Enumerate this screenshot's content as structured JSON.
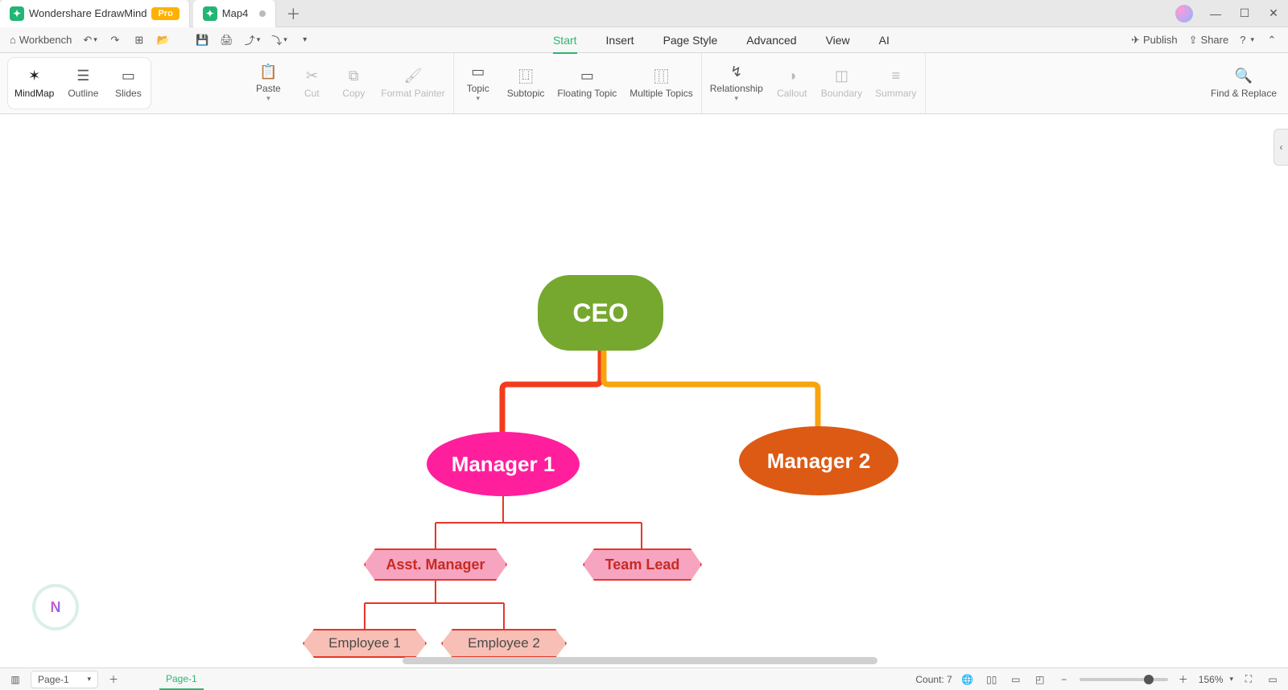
{
  "app": {
    "name": "Wondershare EdrawMind",
    "badge": "Pro",
    "doc_tab": "Map4"
  },
  "quickbar": {
    "workbench": "Workbench",
    "menus": [
      "Start",
      "Insert",
      "Page Style",
      "Advanced",
      "View",
      "AI"
    ],
    "active_menu": "Start",
    "publish": "Publish",
    "share": "Share"
  },
  "ribbon": {
    "viewmodes": [
      "MindMap",
      "Outline",
      "Slides"
    ],
    "active_viewmode": "MindMap",
    "paste": "Paste",
    "cut": "Cut",
    "copy": "Copy",
    "format_painter": "Format Painter",
    "topic": "Topic",
    "subtopic": "Subtopic",
    "floating_topic": "Floating Topic",
    "multiple_topics": "Multiple Topics",
    "relationship": "Relationship",
    "callout": "Callout",
    "boundary": "Boundary",
    "summary": "Summary",
    "find_replace": "Find & Replace"
  },
  "statusbar": {
    "page_select": "Page-1",
    "page_tab": "Page-1",
    "count_label": "Count: 7",
    "zoom": "156%"
  },
  "chart_data": {
    "type": "tree",
    "nodes": [
      {
        "id": "ceo",
        "label": "CEO",
        "shape": "rounded-rect",
        "fill": "#76a82f",
        "text": "#ffffff"
      },
      {
        "id": "m1",
        "label": "Manager 1",
        "shape": "ellipse",
        "fill": "#ff1f9c",
        "text": "#ffffff"
      },
      {
        "id": "m2",
        "label": "Manager 2",
        "shape": "ellipse",
        "fill": "#dd5a14",
        "text": "#ffffff"
      },
      {
        "id": "asst",
        "label": "Asst. Manager",
        "shape": "hexagon",
        "fill": "#f7a4c0",
        "stroke": "#e6362a"
      },
      {
        "id": "team",
        "label": "Team Lead",
        "shape": "hexagon",
        "fill": "#f7a4c0",
        "stroke": "#e6362a"
      },
      {
        "id": "e1",
        "label": "Employee 1",
        "shape": "hexagon",
        "fill": "#f7bfb5",
        "stroke": "#e6362a"
      },
      {
        "id": "e2",
        "label": "Employee 2",
        "shape": "hexagon",
        "fill": "#f7bfb5",
        "stroke": "#e6362a"
      }
    ],
    "edges": [
      {
        "from": "ceo",
        "to": "m1",
        "color": "#f23c1e"
      },
      {
        "from": "ceo",
        "to": "m2",
        "color": "#f7a50f"
      },
      {
        "from": "m1",
        "to": "asst",
        "color": "#e6362a"
      },
      {
        "from": "m1",
        "to": "team",
        "color": "#e6362a"
      },
      {
        "from": "asst",
        "to": "e1",
        "color": "#e6362a"
      },
      {
        "from": "asst",
        "to": "e2",
        "color": "#e6362a"
      }
    ],
    "node_count": 7
  }
}
